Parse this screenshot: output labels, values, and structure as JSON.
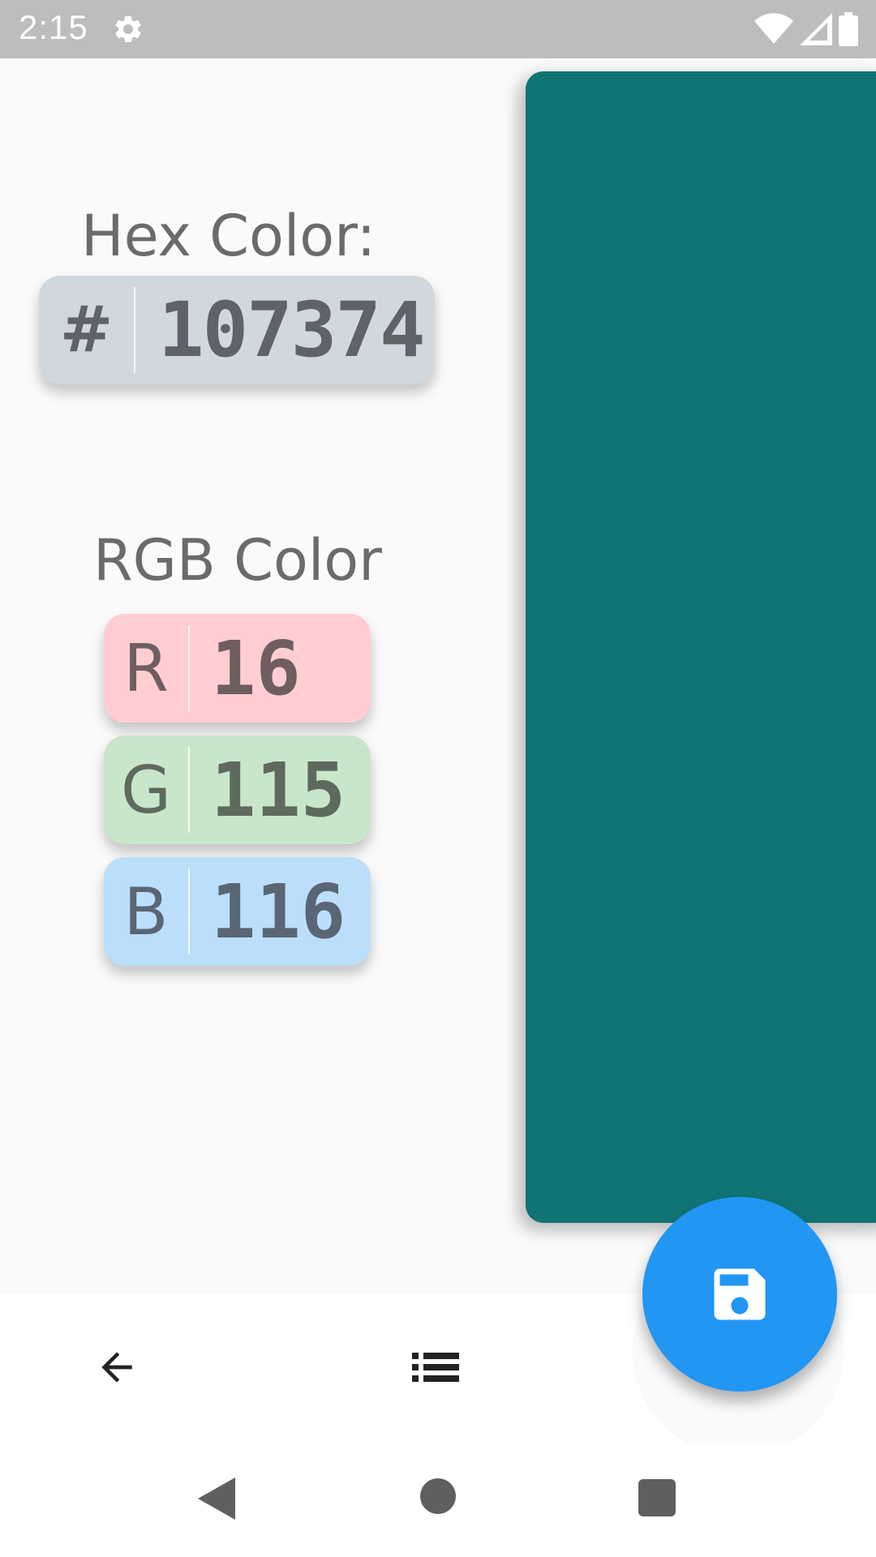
{
  "status_bar": {
    "time": "2:15",
    "settings_icon": "gear-icon",
    "wifi_icon": "wifi-icon",
    "signal_icon": "signal-icon",
    "battery_icon": "battery-icon"
  },
  "color_preview": {
    "color": "#107374"
  },
  "hex": {
    "label": "Hex Color:",
    "prefix": "#",
    "value": "107374"
  },
  "rgb": {
    "label": "RGB Color",
    "channels": [
      {
        "name": "R",
        "value": "16",
        "color": "#ffcdd2"
      },
      {
        "name": "G",
        "value": "115",
        "color": "#c8e6c9"
      },
      {
        "name": "B",
        "value": "116",
        "color": "#bbdefb"
      }
    ]
  },
  "bottom_bar": {
    "back_icon": "arrow-back-icon",
    "list_icon": "list-icon",
    "fab_icon": "save-icon",
    "fab_color": "#2196f3"
  },
  "system_nav": {
    "back_icon": "triangle-back-icon",
    "home_icon": "circle-home-icon",
    "recents_icon": "square-recents-icon"
  }
}
